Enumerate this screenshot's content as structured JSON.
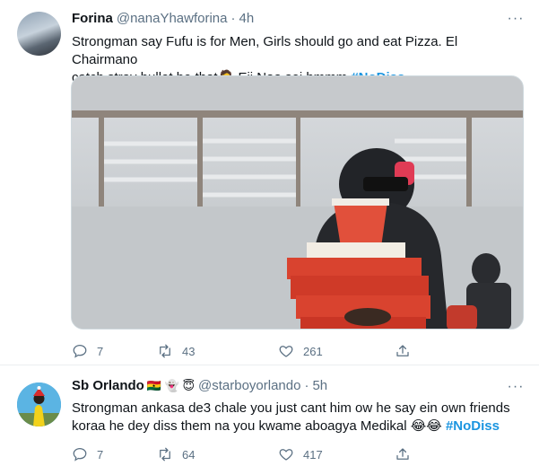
{
  "tweets": [
    {
      "name": "Forina",
      "handle": "@nanaYhawforina",
      "separator": "·",
      "time": "4h",
      "text_line1": "Strongman say Fufu is for Men,  Girls should go and eat Pizza. El Chairmano",
      "text_line2_prefix": "catch stray bullet be that",
      "emoji": "🤦",
      "text_line2_suffix": " Eii Naa sei hmmm ",
      "hashtag": "#NoDiss",
      "replies": "7",
      "retweets": "43",
      "likes": "261"
    },
    {
      "name": "Sb Orlando",
      "name_emojis": "🇬🇭 👻 😇",
      "handle": "@starboyorlando",
      "separator": "·",
      "time": "5h",
      "text_line1": "Strongman ankasa de3 chale you just cant him ow he say ein own friends",
      "text_line2_prefix": "koraa he dey diss them na you kwame aboagya Medikal ",
      "emoji": "😂😂",
      "hashtag": "#NoDiss",
      "replies": "7",
      "retweets": "64",
      "likes": "417"
    }
  ],
  "more_label": "···",
  "colors": {
    "hashtag": "#1b95e0",
    "muted": "#5b7083",
    "text": "#0f1419",
    "divider": "#ebeef0"
  },
  "icons": [
    "reply-icon",
    "retweet-icon",
    "like-icon",
    "share-icon",
    "more-icon"
  ]
}
